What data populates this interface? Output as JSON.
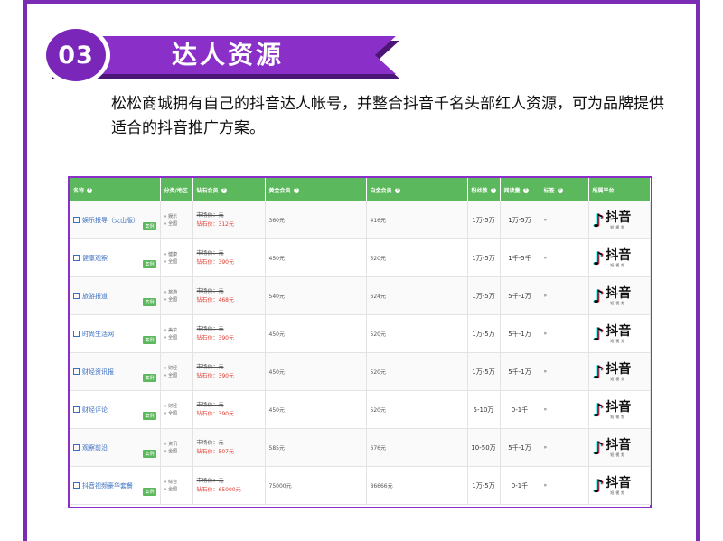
{
  "section": {
    "number": "03",
    "title": "达人资源"
  },
  "intro": "松松商城拥有自己的抖音达人帐号，并整合抖音千名头部红人资源，可为品牌提供适合的抖音推广方案。",
  "colors": {
    "purple": "#8a2fc7",
    "green_header": "#5cb85c",
    "price_red": "#e03a2e"
  },
  "table": {
    "headers": {
      "name": "名称",
      "category": "分类/地区",
      "diamond": "钻石会员",
      "gold": "黄金会员",
      "platinum": "白金会员",
      "fans": "粉丝数",
      "reads": "阅读量",
      "more": "标签",
      "platform": "所属平台"
    },
    "case_label": "案例",
    "rows": [
      {
        "name": "娱乐报导（火山版）",
        "cat1": "娱乐",
        "cat2": "全国",
        "old": "市场价：元",
        "dia": "钻石价：312元",
        "gold": "360元",
        "plat": "416元",
        "fans": "1万-5万",
        "reads": "1万-5万",
        "more": "»",
        "platform": "抖音",
        "platform_sub": "短视频"
      },
      {
        "name": "健康观察",
        "cat1": "健康",
        "cat2": "全国",
        "old": "市场价：元",
        "dia": "钻石价：390元",
        "gold": "450元",
        "plat": "520元",
        "fans": "1万-5万",
        "reads": "1千-5千",
        "more": "»",
        "platform": "抖音",
        "platform_sub": "短视频"
      },
      {
        "name": "旅游报道",
        "cat1": "旅游",
        "cat2": "全国",
        "old": "市场价：元",
        "dia": "钻石价：468元",
        "gold": "540元",
        "plat": "624元",
        "fans": "1万-5万",
        "reads": "5千-1万",
        "more": "»",
        "platform": "抖音",
        "platform_sub": "短视频"
      },
      {
        "name": "时尚生活网",
        "cat1": "美妆",
        "cat2": "全国",
        "old": "市场价：元",
        "dia": "钻石价：390元",
        "gold": "450元",
        "plat": "520元",
        "fans": "1万-5万",
        "reads": "5千-1万",
        "more": "»",
        "platform": "抖音",
        "platform_sub": "短视频"
      },
      {
        "name": "财经资讯报",
        "cat1": "财经",
        "cat2": "全国",
        "old": "市场价：元",
        "dia": "钻石价：390元",
        "gold": "450元",
        "plat": "520元",
        "fans": "1万-5万",
        "reads": "5千-1万",
        "more": "»",
        "platform": "抖音",
        "platform_sub": "短视频"
      },
      {
        "name": "财经评论",
        "cat1": "财经",
        "cat2": "全国",
        "old": "市场价：元",
        "dia": "钻石价：390元",
        "gold": "450元",
        "plat": "520元",
        "fans": "5-10万",
        "reads": "0-1千",
        "more": "»",
        "platform": "抖音",
        "platform_sub": "短视频"
      },
      {
        "name": "观察前沿",
        "cat1": "资讯",
        "cat2": "全国",
        "old": "市场价：元",
        "dia": "钻石价：507元",
        "gold": "585元",
        "plat": "676元",
        "fans": "10-50万",
        "reads": "5千-1万",
        "more": "»",
        "platform": "抖音",
        "platform_sub": "短视频"
      },
      {
        "name": "抖音视频豪华套餐",
        "cat1": "综合",
        "cat2": "全国",
        "old": "市场价：元",
        "dia": "钻石价：65000元",
        "gold": "75000元",
        "plat": "86666元",
        "fans": "1万-5万",
        "reads": "0-1千",
        "more": "»",
        "platform": "抖音",
        "platform_sub": "短视频"
      }
    ]
  }
}
